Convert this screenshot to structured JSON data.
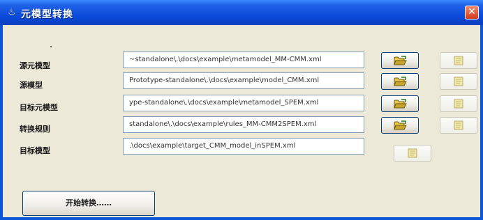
{
  "window": {
    "title": "元模型转换",
    "close_symbol": "✕"
  },
  "rows": [
    {
      "label": "源元模型",
      "value": "~standalone\\.\\docs\\example\\metamodel_MM-CMM.xml"
    },
    {
      "label": "源模型",
      "value": "Prototype-standalone\\.\\docs\\example\\model_CMM.xml"
    },
    {
      "label": "目标元模型",
      "value": "ype-standalone\\.\\docs\\example\\metamodel_SPEM.xml"
    },
    {
      "label": "转换规则",
      "value": "standalone\\.\\docs\\example\\rules_MM-CMM2SPEM.xml"
    },
    {
      "label": "目标模型",
      "value": ".\\docs\\example\\target_CMM_model_inSPEM.xml"
    }
  ],
  "start_button": {
    "label": "开始转换……"
  },
  "icons": {
    "title": "java-cup-icon",
    "open": "open-folder-icon",
    "save": "save-folder-icon"
  }
}
